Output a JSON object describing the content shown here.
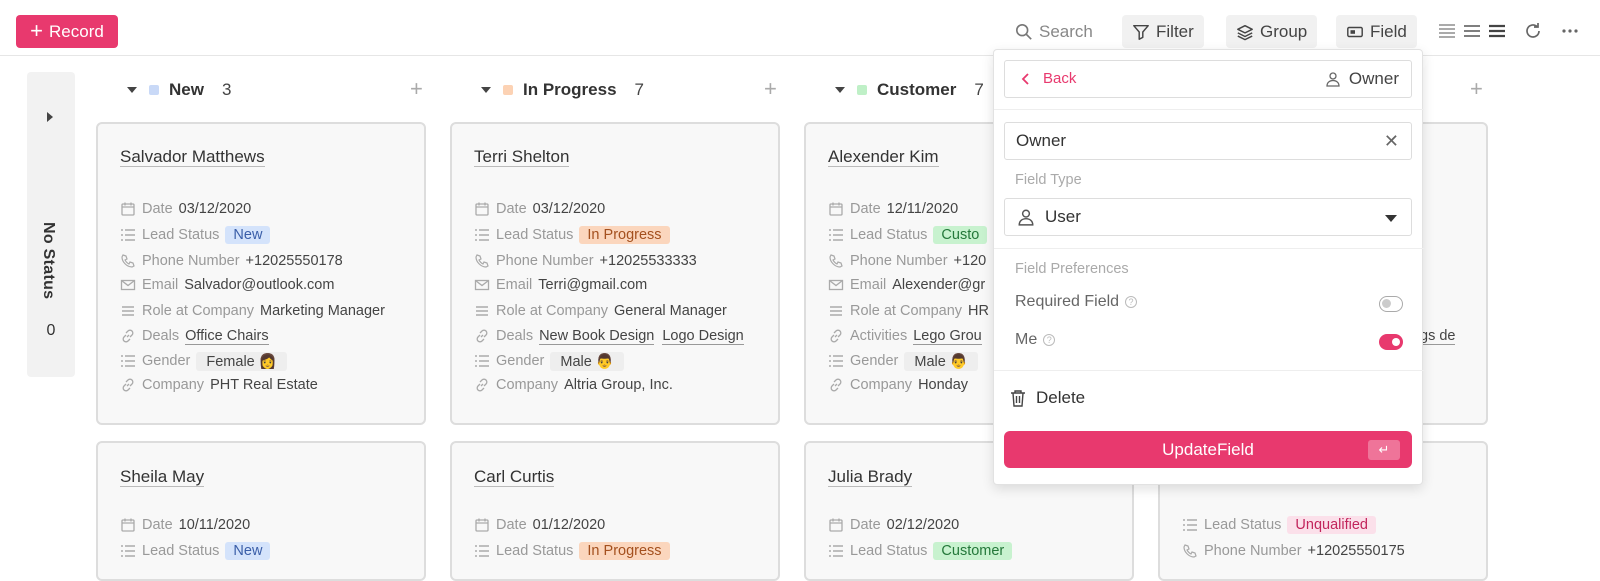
{
  "toolbar": {
    "record_label": "Record",
    "search_label": "Search",
    "filter_label": "Filter",
    "group_label": "Group",
    "field_label": "Field"
  },
  "no_status": {
    "label": "No Status",
    "count": "0"
  },
  "columns": [
    {
      "name": "New",
      "count": "3",
      "color": "#c9d9f7"
    },
    {
      "name": "In Progress",
      "count": "7",
      "color": "#fcd2b4"
    },
    {
      "name": "Customer",
      "count": "7",
      "color": "#bff0c7"
    }
  ],
  "cards": {
    "c1": {
      "name": "Salvador Matthews",
      "date_label": "Date",
      "date": "03/12/2020",
      "status_label": "Lead Status",
      "status": "New",
      "phone_label": "Phone Number",
      "phone": "+12025550178",
      "email_label": "Email",
      "email": "Salvador@outlook.com",
      "role_label": "Role at Company",
      "role": "Marketing Manager",
      "deals_label": "Deals",
      "deals": "Office Chairs",
      "gender_label": "Gender",
      "gender": "Female 👩",
      "company_label": "Company",
      "company": "PHT Real Estate"
    },
    "c2": {
      "name": "Terri Shelton",
      "date_label": "Date",
      "date": "03/12/2020",
      "status_label": "Lead Status",
      "status": "In Progress",
      "phone_label": "Phone Number",
      "phone": "+12025533333",
      "email_label": "Email",
      "email": "Terri@gmail.com",
      "role_label": "Role at Company",
      "role": "General Manager",
      "deals_label": "Deals",
      "deal1": "New Book Design",
      "deal2": "Logo Design",
      "gender_label": "Gender",
      "gender": "Male 👨",
      "company_label": "Company",
      "company": "Altria Group, Inc."
    },
    "c3": {
      "name": "Alexender Kim",
      "date_label": "Date",
      "date": "12/11/2020",
      "status_label": "Lead Status",
      "status": "Custo",
      "phone_label": "Phone Number",
      "phone": "+120",
      "email_label": "Email",
      "email": "Alexender@gr",
      "role_label": "Role at Company",
      "role": "HR",
      "activities_label": "Activities",
      "activities": "Lego Grou",
      "gender_label": "Gender",
      "gender": "Male 👨",
      "company_label": "Company",
      "company": "Honday"
    },
    "c4": {
      "partial": "gs de"
    },
    "c5": {
      "name": "Sheila May",
      "date_label": "Date",
      "date": "10/11/2020",
      "status_label": "Lead Status",
      "status": "New"
    },
    "c6": {
      "name": "Carl Curtis",
      "date_label": "Date",
      "date": "01/12/2020",
      "status_label": "Lead Status",
      "status": "In Progress"
    },
    "c7": {
      "name": "Julia Brady",
      "date_label": "Date",
      "date": "02/12/2020",
      "status_label": "Lead Status",
      "status": "Customer"
    },
    "c8": {
      "status_label": "Lead Status",
      "status": "Unqualified",
      "phone_label": "Phone Number",
      "phone": "+12025550175"
    }
  },
  "popup": {
    "back_label": "Back",
    "owner_label": "Owner",
    "field_name": "Owner",
    "field_type_label": "Field Type",
    "field_type": "User",
    "prefs_label": "Field Preferences",
    "required_label": "Required Field",
    "required_on": false,
    "me_label": "Me",
    "me_on": true,
    "delete_label": "Delete",
    "update_label": "UpdateField",
    "enter_symbol": "↵"
  },
  "colors": {
    "accent": "#e8396e"
  }
}
